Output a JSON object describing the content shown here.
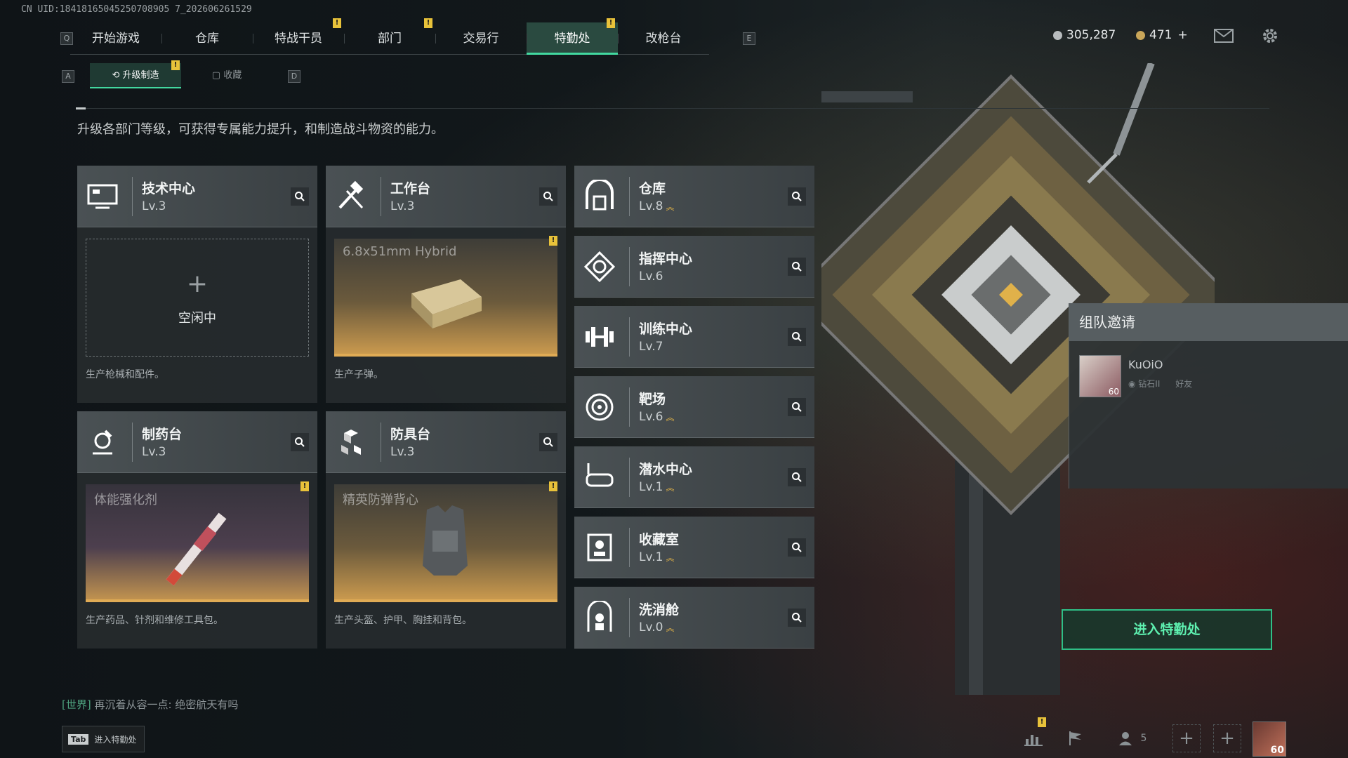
{
  "uid": "CN UID:18418165045250708905 7_202606261529",
  "nav": {
    "q_key": "Q",
    "e_key": "E",
    "tabs": [
      {
        "label": "开始游戏",
        "badge": ""
      },
      {
        "label": "仓库",
        "badge": ""
      },
      {
        "label": "特战干员",
        "badge": "!"
      },
      {
        "label": "部门",
        "badge": "!"
      },
      {
        "label": "交易行",
        "badge": ""
      },
      {
        "label": "特勤处",
        "badge": "!"
      },
      {
        "label": "改枪台",
        "badge": ""
      }
    ]
  },
  "currency": {
    "silver": "305,287",
    "gold": "471",
    "plus": "+"
  },
  "subtabs": {
    "a_key": "A",
    "d_key": "D",
    "upgrade": "升级制造",
    "collect": "收藏",
    "badge": "!"
  },
  "description": "升级各部门等级，可获得专属能力提升，和制造战斗物资的能力。",
  "craft_cards": [
    {
      "title": "技术中心",
      "level": "Lv.3",
      "slot_label": "",
      "empty_plus": "+",
      "empty_text": "空闲中",
      "footer": "生产枪械和配件。"
    },
    {
      "title": "工作台",
      "level": "Lv.3",
      "slot_label": "6.8x51mm Hybrid",
      "footer": "生产子弹。",
      "badge": "!"
    },
    {
      "title": "制药台",
      "level": "Lv.3",
      "slot_label": "体能强化剂",
      "footer": "生产药品、针剂和维修工具包。",
      "badge": "!"
    },
    {
      "title": "防具台",
      "level": "Lv.3",
      "slot_label": "精英防弹背心",
      "footer": "生产头盔、护甲、胸挂和背包。",
      "badge": "!"
    }
  ],
  "departments": [
    {
      "title": "仓库",
      "level": "Lv.8",
      "upgrade": "︽"
    },
    {
      "title": "指挥中心",
      "level": "Lv.6",
      "upgrade": ""
    },
    {
      "title": "训练中心",
      "level": "Lv.7",
      "upgrade": ""
    },
    {
      "title": "靶场",
      "level": "Lv.6",
      "upgrade": "︽"
    },
    {
      "title": "潜水中心",
      "level": "Lv.1",
      "upgrade": "︽"
    },
    {
      "title": "收藏室",
      "level": "Lv.1",
      "upgrade": "︽"
    },
    {
      "title": "洗消舱",
      "level": "Lv.0",
      "upgrade": "︽"
    }
  ],
  "invite": {
    "title": "组队邀请",
    "name": "KuOiO",
    "rank": "钻石II",
    "relation": "好友",
    "level": "60"
  },
  "enter_button": "进入特勤处",
  "chat": {
    "channel": "[世界]",
    "message": "再沉着从容一点: 绝密航天有吗"
  },
  "tab_hint": {
    "key": "Tab",
    "label": "进入特勤处"
  },
  "bottom": {
    "friends_count": "5",
    "player_level": "60",
    "badge": "!"
  },
  "colors": {
    "accent": "#42d9a0",
    "badge": "#e8c23a",
    "upgrade": "#e2b447"
  }
}
